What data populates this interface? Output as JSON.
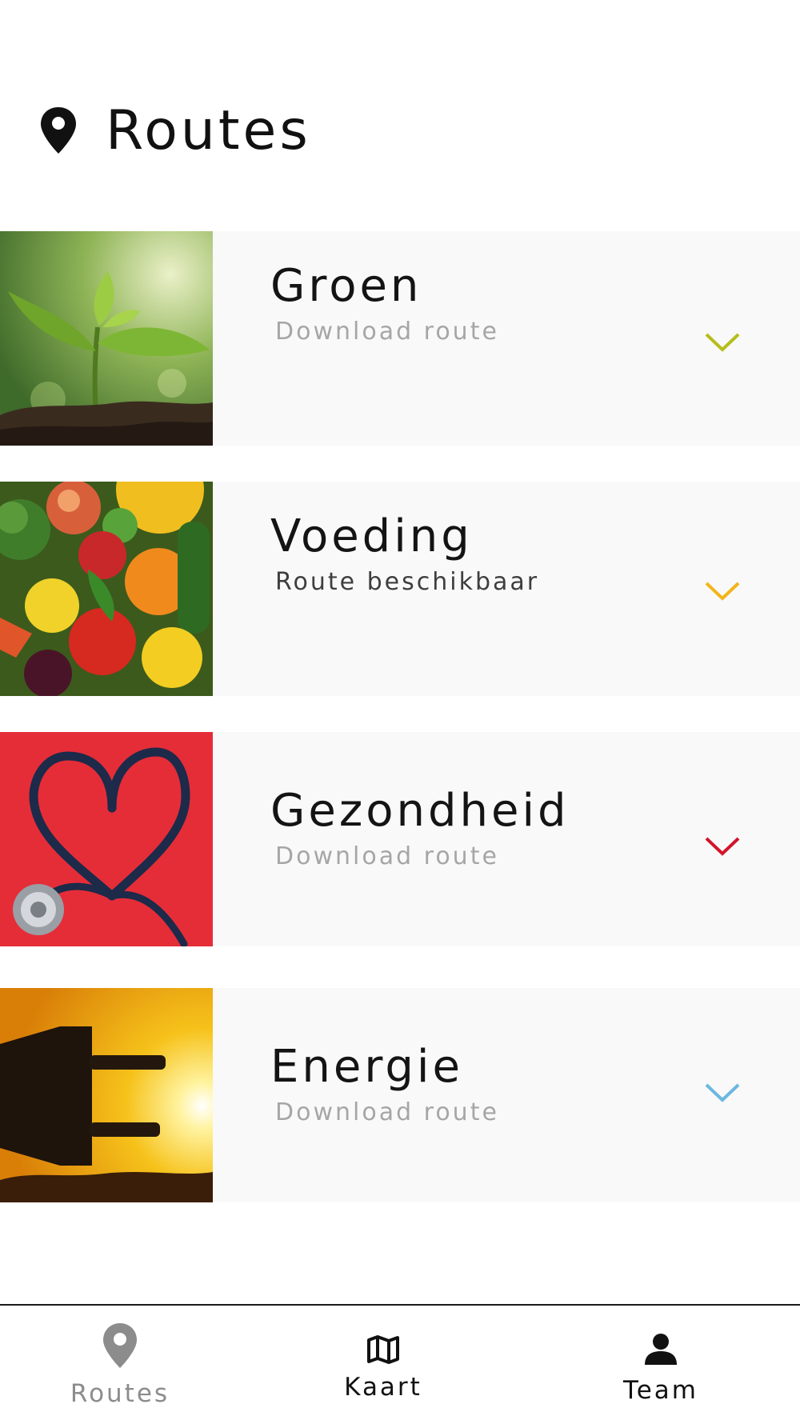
{
  "header": {
    "title": "Routes",
    "icon": "map-pin-icon"
  },
  "routes": [
    {
      "name": "Groen",
      "status": "Download route",
      "accent": "#b5bd1a",
      "image": "seedling-photo"
    },
    {
      "name": "Voeding",
      "status": "Route beschikbaar",
      "accent": "#f3b51b",
      "image": "vegetables-photo"
    },
    {
      "name": "Gezondheid",
      "status": "Download route",
      "accent": "#d3142b",
      "image": "stethoscope-heart-photo"
    },
    {
      "name": "Energie",
      "status": "Download route",
      "accent": "#6cb8e0",
      "image": "power-plug-sunset-photo"
    }
  ],
  "nav": {
    "items": [
      {
        "label": "Routes",
        "icon": "map-pin-icon",
        "color": "#8c8c8c"
      },
      {
        "label": "Kaart",
        "icon": "map-icon",
        "color": "#111111"
      },
      {
        "label": "Team",
        "icon": "person-icon",
        "color": "#111111"
      }
    ]
  }
}
